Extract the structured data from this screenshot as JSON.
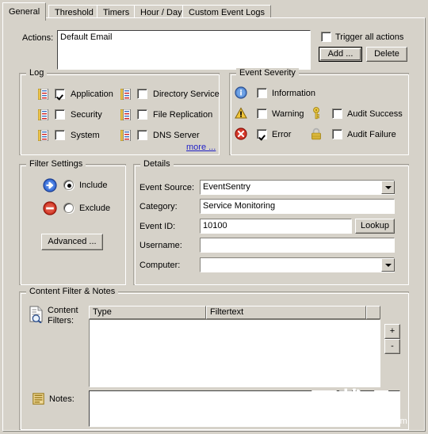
{
  "window": {
    "tabs": [
      {
        "label": "General",
        "active": true
      },
      {
        "label": "Threshold",
        "active": false
      },
      {
        "label": "Timers",
        "active": false
      },
      {
        "label": "Hour / Day",
        "active": false
      },
      {
        "label": "Custom Event Logs",
        "active": false
      }
    ]
  },
  "actions": {
    "label": "Actions:",
    "list_items": [
      "Default Email"
    ],
    "trigger_all": {
      "label": "Trigger all actions",
      "checked": false
    },
    "add_button": "Add ...",
    "delete_button": "Delete"
  },
  "log_group": {
    "title": "Log",
    "left_column": [
      {
        "label": "Application",
        "checked": true,
        "icon": "event-log-icon"
      },
      {
        "label": "Security",
        "checked": false,
        "icon": "event-log-icon"
      },
      {
        "label": "System",
        "checked": false,
        "icon": "event-log-icon"
      }
    ],
    "right_column": [
      {
        "label": "Directory Service",
        "checked": false,
        "icon": "event-log-icon"
      },
      {
        "label": "File Replication",
        "checked": false,
        "icon": "event-log-icon"
      },
      {
        "label": "DNS Server",
        "checked": false,
        "icon": "event-log-icon"
      }
    ],
    "more_link": "more ..."
  },
  "severity_group": {
    "title": "Event Severity",
    "left_column": [
      {
        "label": "Information",
        "checked": false,
        "icon": "information-icon"
      },
      {
        "label": "Warning",
        "checked": false,
        "icon": "warning-icon"
      },
      {
        "label": "Error",
        "checked": true,
        "icon": "error-icon"
      }
    ],
    "right_column": [
      {
        "label": "Audit Success",
        "checked": false,
        "icon": "key-icon"
      },
      {
        "label": "Audit Failure",
        "checked": false,
        "icon": "padlock-icon"
      }
    ]
  },
  "filter_settings": {
    "title": "Filter Settings",
    "options": [
      {
        "label": "Include",
        "selected": true,
        "icon": "blue-arrow-icon"
      },
      {
        "label": "Exclude",
        "selected": false,
        "icon": "red-minus-icon"
      }
    ],
    "advanced_button": "Advanced ..."
  },
  "details": {
    "title": "Details",
    "fields": [
      {
        "label": "Event Source:",
        "value": "EventSentry",
        "type": "combo",
        "placeholder": ""
      },
      {
        "label": "Category:",
        "value": "Service Monitoring",
        "type": "text",
        "placeholder": ""
      },
      {
        "label": "Event ID:",
        "value": "10100",
        "type": "text",
        "placeholder": ""
      },
      {
        "label": "Username:",
        "value": "",
        "type": "text",
        "placeholder": ""
      },
      {
        "label": "Computer:",
        "value": "",
        "type": "combo",
        "placeholder": ""
      }
    ],
    "lookup_button": "Lookup"
  },
  "content_filter": {
    "title": "Content Filter & Notes",
    "filters_label_line1": "Content",
    "filters_label_line2": "Filters:",
    "filters_icon": "document-search-icon",
    "columns": [
      "Type",
      "Filtertext",
      ""
    ],
    "rows": [],
    "add_row_button": "+",
    "remove_row_button": "-",
    "notes_label": "Notes:",
    "notes_icon": "notes-icon",
    "notes_value": "",
    "notes_placeholder": ""
  },
  "watermark": {
    "text": "下载吧",
    "url": "www.xiazaiba.com"
  },
  "colors": {
    "window_bg": "#d6d2c9",
    "link": "#2323c8",
    "information": "#3a6fbf",
    "warning": "#e8b31c",
    "error": "#cc2020",
    "key": "#e8c53c",
    "padlock": "#e8c044",
    "include_arrow": "#2a5fc8",
    "exclude_minus": "#cc3322"
  }
}
